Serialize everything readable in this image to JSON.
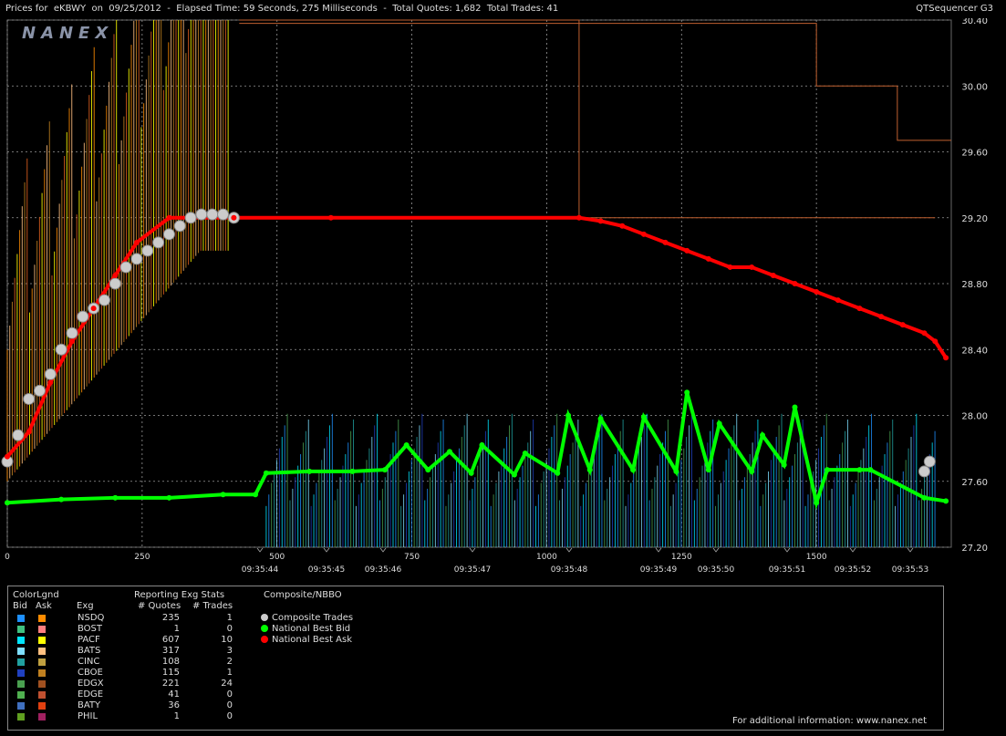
{
  "header": {
    "title": "Prices for  eKBWY  on  09/25/2012  -  Elapsed Time: 59 Seconds, 275 Milliseconds  -  Total Quotes: 1,682  Total Trades: 41",
    "app_name": "QTSequencer G3"
  },
  "watermark": "NANEX",
  "chart_data": {
    "type": "line",
    "title": "",
    "y_ticks": [
      "30.40",
      "30.00",
      "29.60",
      "29.20",
      "28.80",
      "28.40",
      "28.00",
      "27.60",
      "27.20"
    ],
    "ylim": [
      27.2,
      30.4
    ],
    "x_ticks_top": [
      "0",
      "250",
      "500",
      "750",
      "1000",
      "1250",
      "1500"
    ],
    "x_ticks_time": [
      "09:35:44",
      "09:35:45",
      "09:35:46",
      "09:35:47",
      "09:35:48",
      "09:35:49",
      "09:35:50",
      "09:35:51",
      "09:35:52",
      "09:35:53"
    ],
    "xlim": [
      0,
      1750
    ],
    "grid": true,
    "series": [
      {
        "name": "National Best Ask",
        "x": [
          0,
          40,
          80,
          120,
          160,
          200,
          240,
          300,
          420,
          600,
          1060,
          1100,
          1140,
          1180,
          1220,
          1260,
          1300,
          1340,
          1380,
          1420,
          1460,
          1500,
          1540,
          1580,
          1620,
          1660,
          1700,
          1720,
          1740
        ],
        "y": [
          27.75,
          27.9,
          28.2,
          28.45,
          28.65,
          28.85,
          29.05,
          29.2,
          29.2,
          29.2,
          29.2,
          29.18,
          29.15,
          29.1,
          29.05,
          29.0,
          28.95,
          28.9,
          28.9,
          28.85,
          28.8,
          28.75,
          28.7,
          28.65,
          28.6,
          28.55,
          28.5,
          28.45,
          28.35
        ]
      },
      {
        "name": "National Best Bid",
        "x": [
          0,
          100,
          200,
          300,
          400,
          460,
          480,
          560,
          640,
          700,
          740,
          780,
          820,
          860,
          880,
          940,
          960,
          1020,
          1040,
          1080,
          1100,
          1160,
          1180,
          1240,
          1260,
          1300,
          1320,
          1380,
          1400,
          1440,
          1460,
          1500,
          1520,
          1580,
          1600,
          1700,
          1740
        ],
        "y": [
          27.47,
          27.49,
          27.5,
          27.5,
          27.52,
          27.52,
          27.65,
          27.66,
          27.66,
          27.67,
          27.82,
          27.67,
          27.78,
          27.65,
          27.82,
          27.64,
          27.77,
          27.65,
          28.0,
          27.67,
          27.98,
          27.67,
          27.99,
          27.66,
          28.14,
          27.67,
          27.95,
          27.66,
          27.88,
          27.7,
          28.05,
          27.47,
          27.67,
          27.67,
          27.67,
          27.5,
          27.48
        ]
      },
      {
        "name": "Composite Trades",
        "x": [
          0,
          20,
          40,
          60,
          80,
          100,
          120,
          140,
          160,
          180,
          200,
          220,
          240,
          260,
          280,
          300,
          320,
          340,
          360,
          380,
          400,
          420,
          1700,
          1710
        ],
        "y": [
          27.72,
          27.88,
          28.1,
          28.15,
          28.25,
          28.4,
          28.5,
          28.6,
          28.65,
          28.7,
          28.8,
          28.9,
          28.95,
          29.0,
          29.05,
          29.1,
          29.15,
          29.2,
          29.22,
          29.22,
          29.22,
          29.2,
          27.66,
          27.72
        ]
      }
    ]
  },
  "legend": {
    "colorlgnd_label": "ColorLgnd",
    "bid_label": "Bid",
    "ask_label": "Ask",
    "exg_label": "Exg",
    "reporting_label": "Reporting Exg Stats",
    "quotes_label": "# Quotes",
    "trades_label": "# Trades",
    "composite_label": "Composite/NBBO",
    "rows": [
      {
        "exg": "NSDQ",
        "quotes": "235",
        "trades": "1",
        "bid": "#1e90ff",
        "ask": "#ff8c00"
      },
      {
        "exg": "BOST",
        "quotes": "1",
        "trades": "0",
        "bid": "#40c080",
        "ask": "#ff7f7f"
      },
      {
        "exg": "PACF",
        "quotes": "607",
        "trades": "10",
        "bid": "#00e5ff",
        "ask": "#ffff00"
      },
      {
        "exg": "BATS",
        "quotes": "317",
        "trades": "3",
        "bid": "#7fdfff",
        "ask": "#ffc080"
      },
      {
        "exg": "CINC",
        "quotes": "108",
        "trades": "2",
        "bid": "#20a0a0",
        "ask": "#c0a040"
      },
      {
        "exg": "CBOE",
        "quotes": "115",
        "trades": "1",
        "bid": "#2040c0",
        "ask": "#c08020"
      },
      {
        "exg": "EDGX",
        "quotes": "221",
        "trades": "24",
        "bid": "#4aa050",
        "ask": "#a05020"
      },
      {
        "exg": "EDGE",
        "quotes": "41",
        "trades": "0",
        "bid": "#50b050",
        "ask": "#c05030"
      },
      {
        "exg": "BATY",
        "quotes": "36",
        "trades": "0",
        "bid": "#4070c0",
        "ask": "#e04010"
      },
      {
        "exg": "PHIL",
        "quotes": "1",
        "trades": "0",
        "bid": "#60a020",
        "ask": "#a02060"
      }
    ],
    "composite": [
      {
        "label": "Composite Trades",
        "color": "#cccccc"
      },
      {
        "label": "National Best Bid",
        "color": "#00ff00"
      },
      {
        "label": "National Best Ask",
        "color": "#ff0000"
      }
    ]
  },
  "footer": "For additional information: www.nanex.net"
}
